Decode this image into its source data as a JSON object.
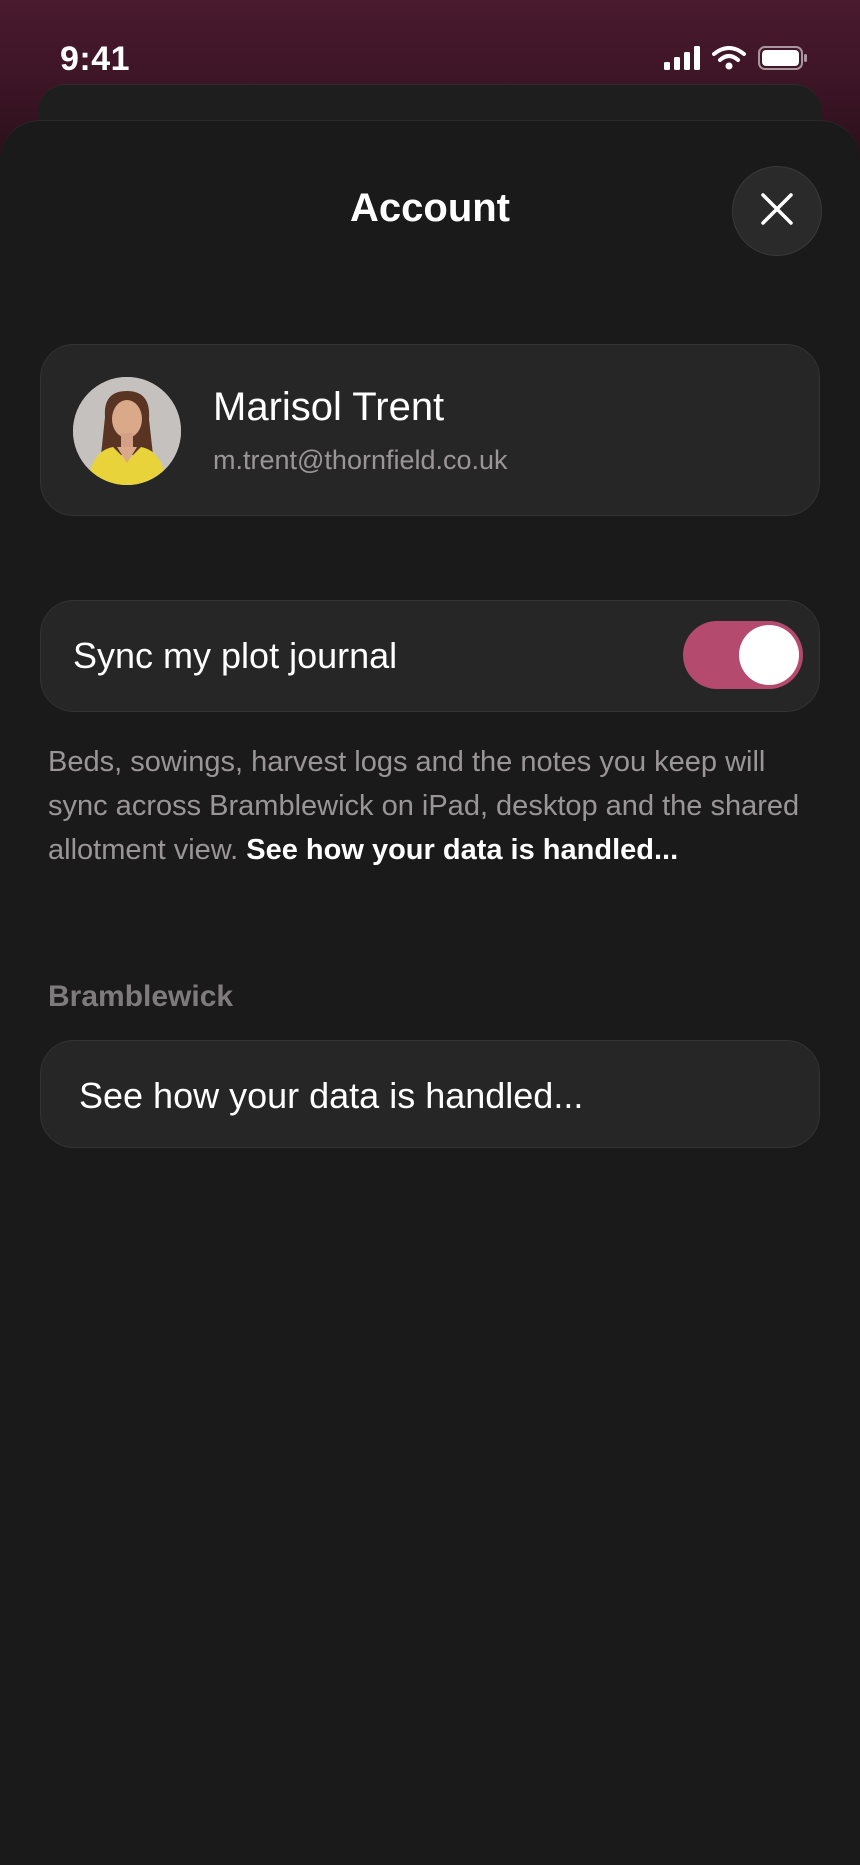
{
  "status_bar": {
    "time": "9:41",
    "icons": [
      "cellular-signal-icon",
      "wifi-icon",
      "battery-icon"
    ]
  },
  "sheet": {
    "title": "Account",
    "close_icon": "close-icon"
  },
  "profile": {
    "name": "Marisol Trent",
    "email": "m.trent@thornfield.co.uk"
  },
  "sync": {
    "label": "Sync my plot journal",
    "enabled": true,
    "description": "Beds, sowings, harvest logs and the notes you keep will sync across Bramblewick on iPad, desktop and the shared allotment view.",
    "link_text": "See how your data is handled..."
  },
  "section": {
    "header": "Bramblewick",
    "item_label": "See how your data is handled..."
  },
  "colors": {
    "accent": "#b44a6d",
    "background": "#1b1a1a",
    "card": "#272626",
    "header_gradient_top": "#4a1a2e"
  }
}
